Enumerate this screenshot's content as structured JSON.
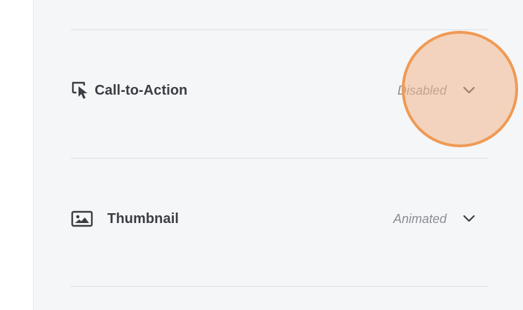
{
  "settings": {
    "rows": [
      {
        "title": "Call-to-Action",
        "status": "Disabled",
        "icon": "cursor-click-icon"
      },
      {
        "title": "Thumbnail",
        "status": "Animated",
        "icon": "image-icon"
      }
    ]
  },
  "colors": {
    "panel_bg": "#f5f6f8",
    "divider": "#dcdee2",
    "title_text": "#3a3d42",
    "status_text": "#8a8d93",
    "click_indicator_fill": "#f0b78c",
    "click_indicator_border": "#ef9a55"
  }
}
